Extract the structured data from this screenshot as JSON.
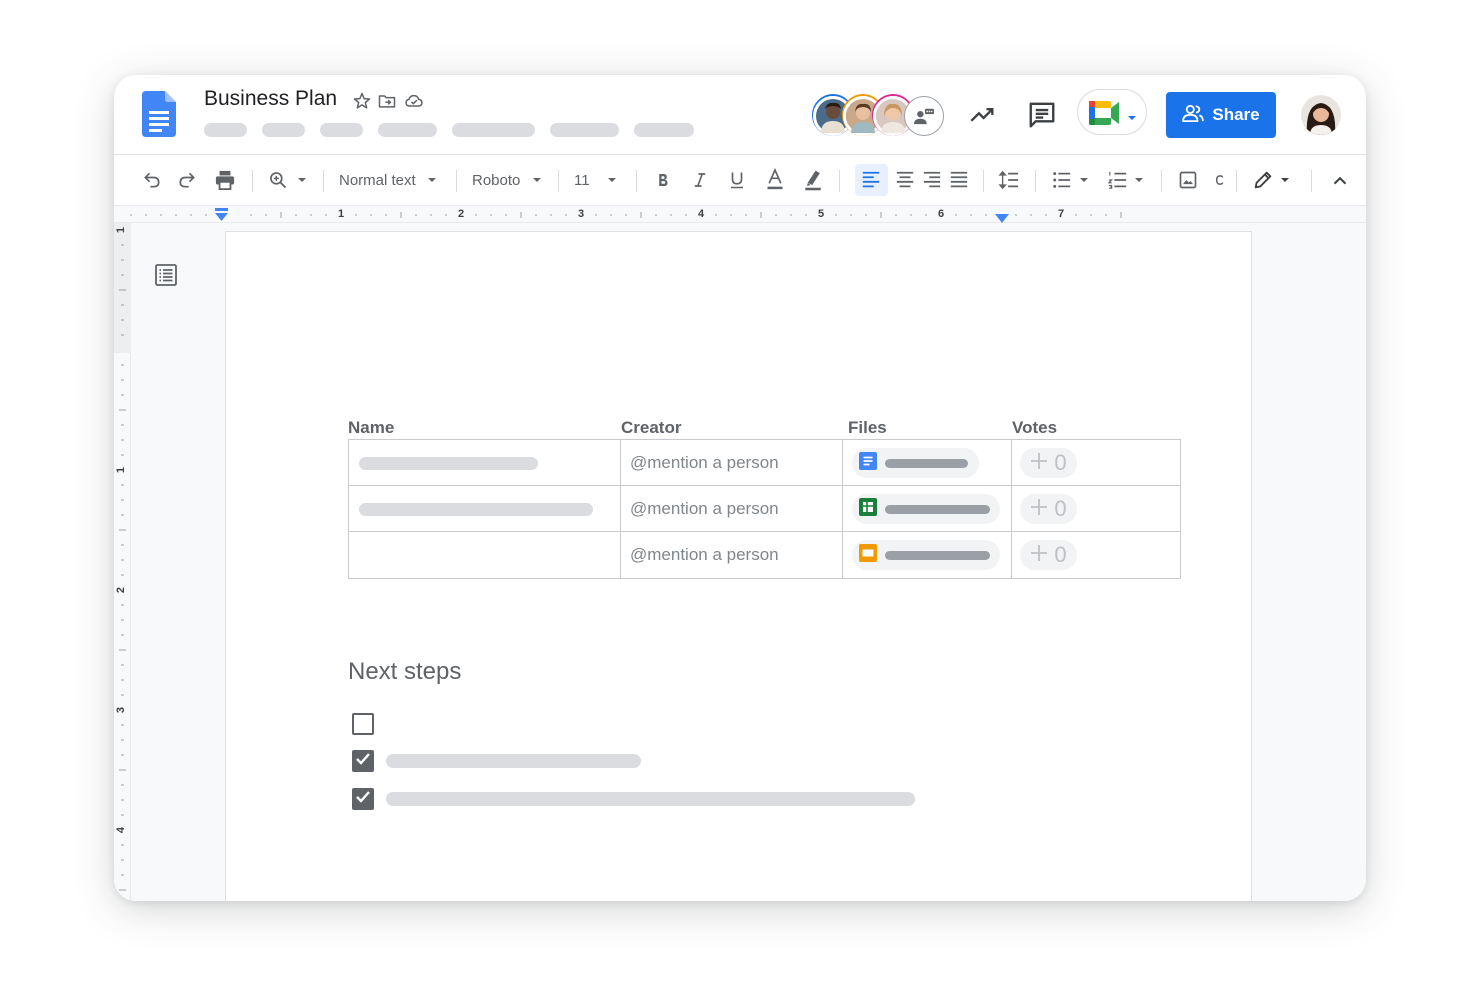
{
  "header": {
    "title": "Business Plan",
    "share_label": "Share"
  },
  "toolbar": {
    "style": "Normal text",
    "font": "Roboto",
    "size": "11"
  },
  "ruler": {
    "numbers": [
      "1",
      "2",
      "3",
      "4",
      "5",
      "6",
      "7"
    ],
    "vertical_numbers": [
      "1",
      "1",
      "2",
      "3",
      "4"
    ]
  },
  "table": {
    "headers": [
      "Name",
      "Creator",
      "Files",
      "Votes"
    ],
    "rows": [
      {
        "creator": "@mention a person",
        "file_type": "docs",
        "votes": "0"
      },
      {
        "creator": "@mention a person",
        "file_type": "sheets",
        "votes": "0"
      },
      {
        "creator": "@mention a person",
        "file_type": "slides",
        "votes": "0"
      }
    ]
  },
  "next_steps": {
    "title": "Next steps",
    "items": [
      {
        "checked": false
      },
      {
        "checked": true
      },
      {
        "checked": true
      }
    ]
  },
  "colors": {
    "accent": "#1a73e8",
    "docs": "#4285f4",
    "sheets": "#188038",
    "slides": "#f29900"
  }
}
